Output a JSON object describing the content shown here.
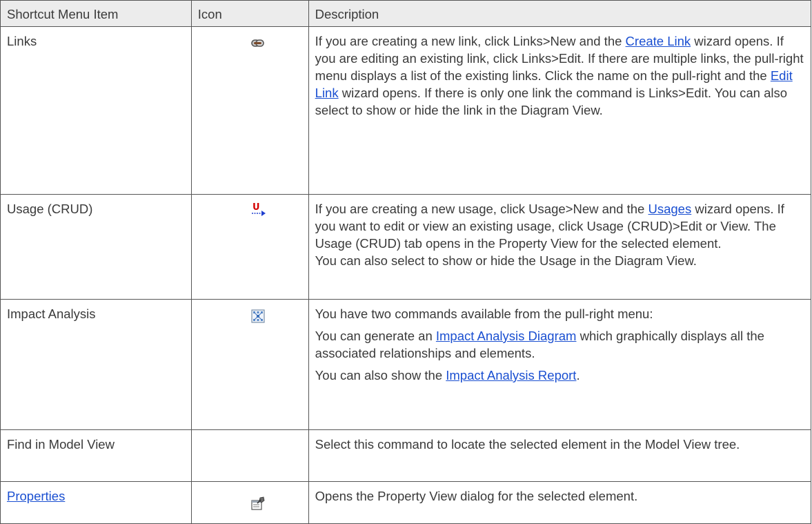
{
  "headers": {
    "item": "Shortcut  Menu Item",
    "icon": "Icon",
    "description": "Description"
  },
  "rows": [
    {
      "item": "Links",
      "icon": "chain-link-icon",
      "desc": [
        "If you are creating a new link, click Links>New and the ",
        "Create Link",
        " wizard opens. If you are editing an existing link, click Links>Edit. If there are multiple links, the pull-right menu displays a list of the existing links. Click the name on the pull-right and the ",
        "Edit Link",
        " wizard opens. If there is only one link the command is Links>Edit. You can also select to show or hide the link in the Diagram View."
      ]
    },
    {
      "item": "Usage (CRUD)",
      "icon": "usage-arrow-icon",
      "icon_letter": "U",
      "desc": [
        "If you are creating a new usage, click Usage>New and the ",
        "Usages",
        " wizard opens. If you want to edit or view an existing usage, click Usage (CRUD)>Edit or View. The Usage (CRUD) tab opens in the Property View for the selected element.",
        "You can also select to show or hide the Usage in the Diagram View."
      ]
    },
    {
      "item": "Impact Analysis",
      "icon": "impact-analysis-icon",
      "paras": [
        "You have two commands available from the pull-right menu:",
        "You can generate an ",
        "Impact Analysis Diagram",
        " which graphically displays all the associated relationships and elements.",
        "You can also show the ",
        "Impact Analysis Report",
        "."
      ]
    },
    {
      "item": "Find in Model View",
      "icon": "",
      "desc": "Select this command to locate the selected element in the Model View tree."
    },
    {
      "item": "Properties",
      "icon": "properties-icon",
      "desc": "Opens the Property View dialog for the selected element."
    }
  ],
  "colors": {
    "link": "#1a4fd1",
    "header_bg": "#ececec",
    "border": "#555555",
    "text": "#3a3a3a",
    "usage_icon_letter": "#d40000",
    "usage_icon_arrow": "#1f3fd0"
  }
}
